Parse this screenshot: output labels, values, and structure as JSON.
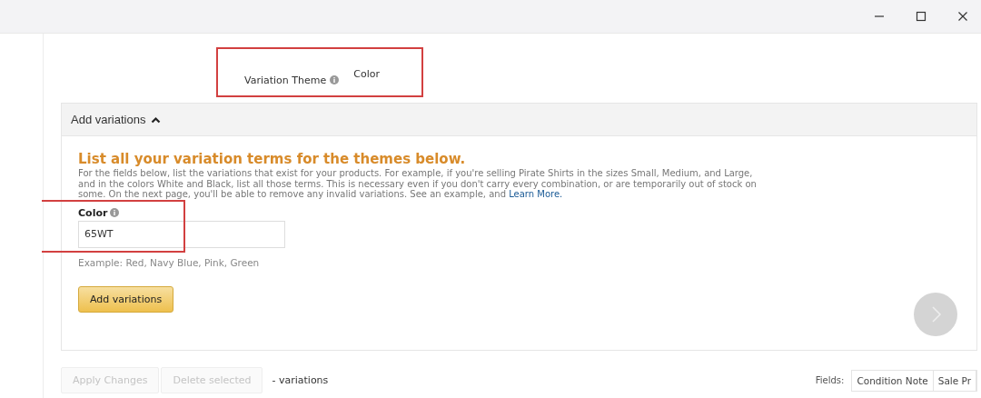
{
  "variation_theme": {
    "label": "Variation Theme",
    "value": "Color"
  },
  "add_variations": {
    "title": "Add variations",
    "expanded": true,
    "heading": "List all your variation terms for the themes below.",
    "description": "For the fields below, list the variations that exist for your products. For example, if you're selling Pirate Shirts in the sizes Small, Medium, and Large, and in the colors White and Black, list all those terms. This is necessary even if you don't carry every combination, or are temporarily out of stock on some. On the next page, you'll be able to remove any invalid variations. See an example, and",
    "link": "Learn More.",
    "field": {
      "label": "Color",
      "value": "65WT",
      "example": "Example: Red, Navy Blue, Pink, Green"
    },
    "button": "Add variations"
  },
  "toolbar": {
    "buttons": [
      {
        "label": "Apply Changes",
        "disabled": true
      },
      {
        "label": "Delete selected",
        "disabled": true
      }
    ],
    "count_text": "- variations",
    "fields_label": "Fields:",
    "field_buttons": [
      "Condition Note",
      "Sale Pr"
    ]
  }
}
